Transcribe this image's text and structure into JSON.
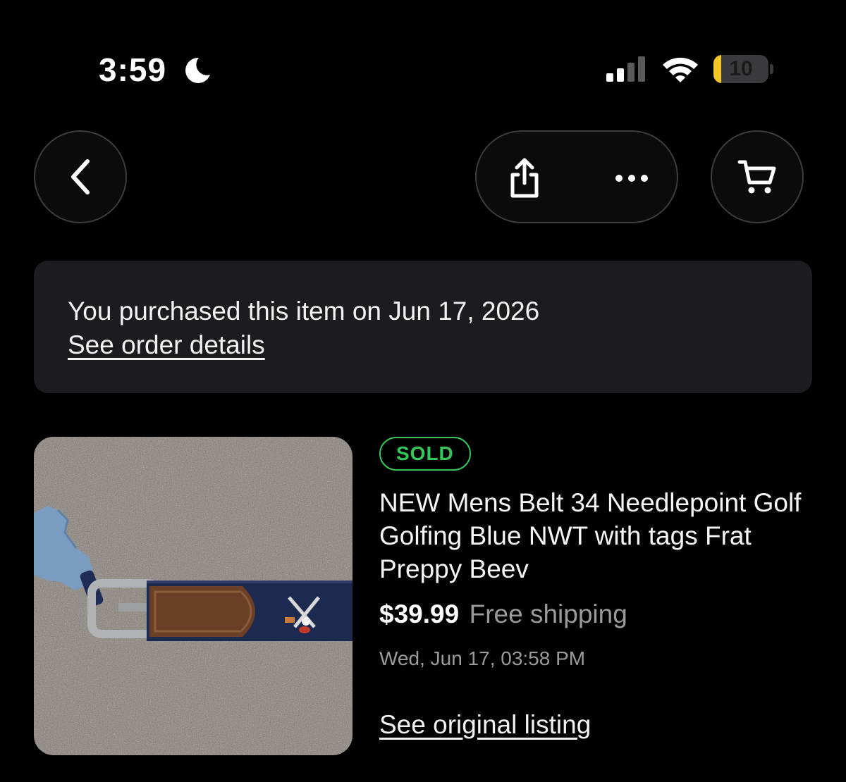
{
  "status_bar": {
    "time": "3:59",
    "battery_percent": 10,
    "battery_label": "10",
    "battery_color": "#f3c623",
    "signal_bars_active": 2,
    "signal_bars_total": 4
  },
  "nav": {
    "back_icon": "chevron-left-icon",
    "share_icon": "share-icon",
    "more_icon": "more-horizontal-icon",
    "cart_icon": "cart-icon"
  },
  "banner": {
    "text": "You purchased this item on Jun 17, 2026",
    "link": "See order details"
  },
  "product": {
    "status_badge": "SOLD",
    "status_color": "#35c759",
    "title": "NEW Mens Belt 34 Needlepoint Golf Golfing Blue NWT with tags Frat Preppy Beev",
    "price": "$39.99",
    "shipping": "Free shipping",
    "date": "Wed, Jun 17, 03:58 PM",
    "original_listing_link": "See original listing"
  }
}
